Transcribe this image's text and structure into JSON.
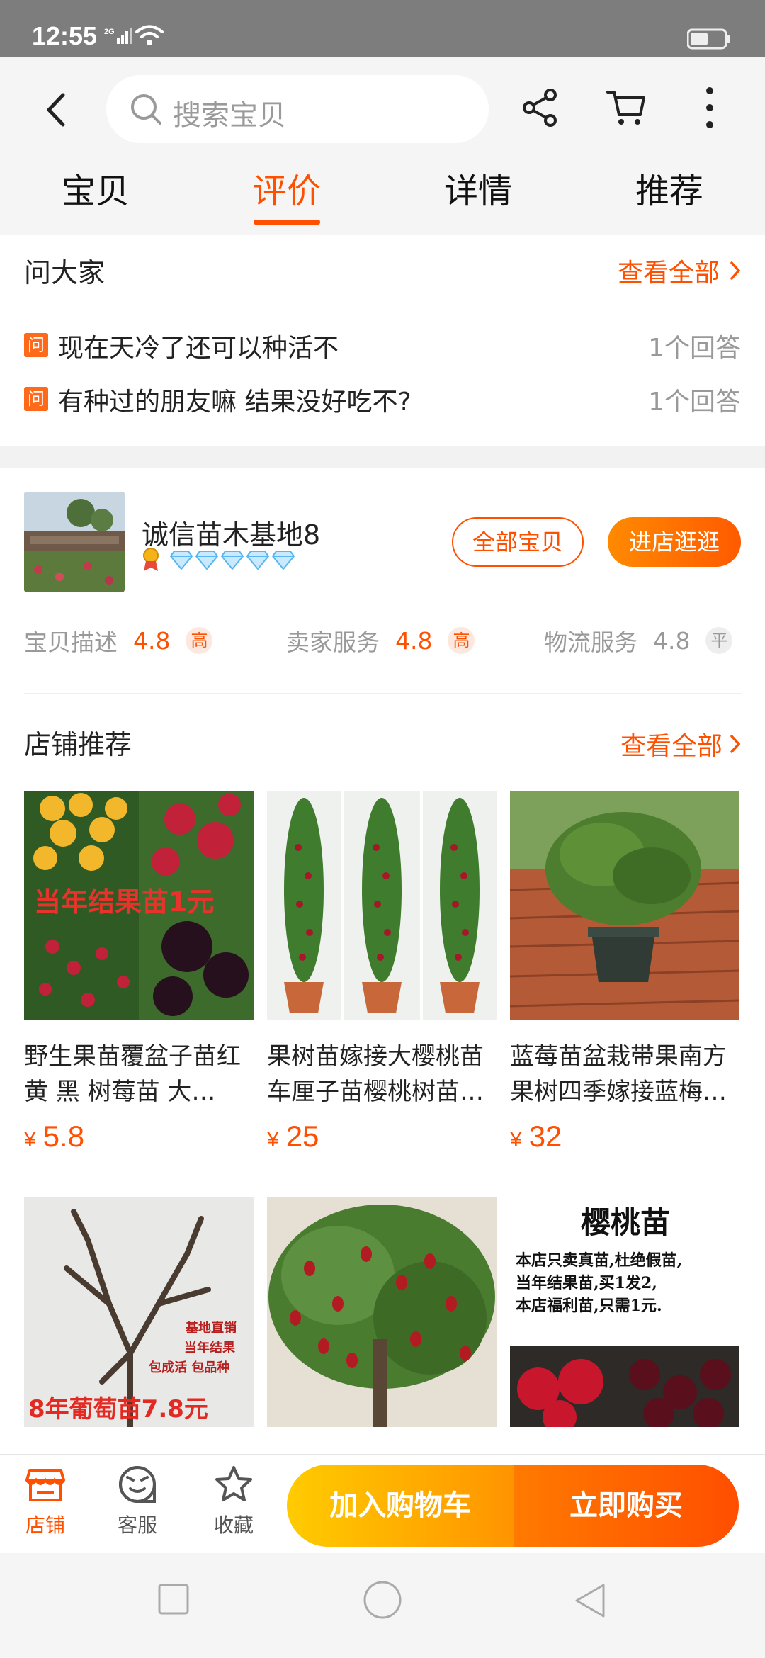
{
  "status_bar": {
    "time": "12:55",
    "network": "2G"
  },
  "nav": {
    "search_placeholder": "搜索宝贝",
    "icons": [
      "back-icon",
      "search-icon",
      "share-icon",
      "cart-icon",
      "more-icon"
    ]
  },
  "tabs": [
    {
      "label": "宝贝",
      "active": false
    },
    {
      "label": "评价",
      "active": true
    },
    {
      "label": "详情",
      "active": false
    },
    {
      "label": "推荐",
      "active": false
    }
  ],
  "ask": {
    "title": "问大家",
    "see_all": "查看全部",
    "badge": "问",
    "questions": [
      {
        "text": "现在天冷了还可以种活不",
        "answers": "1个回答"
      },
      {
        "text": "有种过的朋友嘛 结果没好吃不?",
        "answers": "1个回答"
      }
    ]
  },
  "shop": {
    "name": "诚信苗木基地8",
    "diamonds": 5,
    "all_items_label": "全部宝贝",
    "visit_label": "进店逛逛",
    "ratings": [
      {
        "label": "宝贝描述",
        "score": "4.8",
        "level": "高"
      },
      {
        "label": "卖家服务",
        "score": "4.8",
        "level": "高"
      },
      {
        "label": "物流服务",
        "score": "4.8",
        "level": "平"
      }
    ]
  },
  "recommend": {
    "title": "店铺推荐",
    "see_all": "查看全部",
    "currency": "¥",
    "products": [
      {
        "title": "野生果苗覆盆子苗红 黄 黑 树莓苗 大…",
        "price": "5.8",
        "img_text": "当年结果苗1元"
      },
      {
        "title": "果树苗嫁接大樱桃苗车厘子苗樱桃树苗…",
        "price": "25",
        "img_text": ""
      },
      {
        "title": "蓝莓苗盆栽带果南方果树四季嫁接蓝梅…",
        "price": "32",
        "img_text": ""
      },
      {
        "title": "",
        "price": "",
        "img_text": "8年葡萄苗7.8元",
        "img_subtext": "基地直销 当年结果 包成活 包品种"
      },
      {
        "title": "",
        "price": "",
        "img_text": ""
      },
      {
        "title": "",
        "price": "",
        "img_text": "樱桃苗",
        "img_subtext": "本店只卖真苗,杜绝假苗, 当年结果苗,买1发2, 本店福利苗,只需1元."
      }
    ]
  },
  "bottom_bar": {
    "shop_label": "店铺",
    "service_label": "客服",
    "favorite_label": "收藏",
    "add_cart_label": "加入购物车",
    "buy_now_label": "立即购买"
  },
  "colors": {
    "accent": "#ff5000",
    "status_bar": "#7d7d7d"
  }
}
